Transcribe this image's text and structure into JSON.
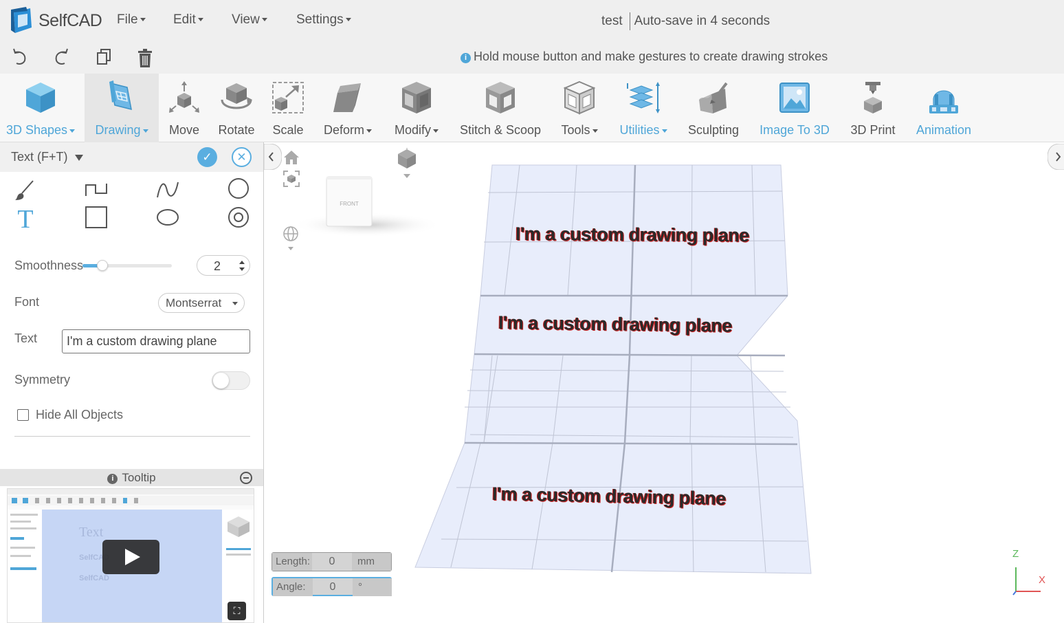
{
  "app": {
    "name": "SelfCAD"
  },
  "menu": [
    {
      "label": "File"
    },
    {
      "label": "Edit"
    },
    {
      "label": "View"
    },
    {
      "label": "Settings"
    }
  ],
  "document": {
    "name": "test",
    "autosave": "Auto-save in 4 seconds"
  },
  "hint": {
    "icon": "i",
    "text": "Hold mouse button and make gestures to create drawing strokes"
  },
  "toolbar": {
    "items": [
      {
        "label": "3D Shapes",
        "icon": "cube-icon",
        "dropdown": true,
        "color": "#4fa6d8"
      },
      {
        "label": "Drawing",
        "icon": "drawing-icon",
        "dropdown": true,
        "color": "#4fa6d8",
        "active": true
      },
      {
        "label": "Move",
        "icon": "move-icon"
      },
      {
        "label": "Rotate",
        "icon": "rotate-icon"
      },
      {
        "label": "Scale",
        "icon": "scale-icon"
      },
      {
        "label": "Deform",
        "icon": "deform-icon",
        "dropdown": true
      },
      {
        "label": "Modify",
        "icon": "modify-icon",
        "dropdown": true
      },
      {
        "label": "Stitch & Scoop",
        "icon": "stitch-icon"
      },
      {
        "label": "Tools",
        "icon": "tools-icon",
        "dropdown": true
      },
      {
        "label": "Utilities",
        "icon": "utilities-icon",
        "dropdown": true,
        "color": "#4fa6d8"
      },
      {
        "label": "Sculpting",
        "icon": "sculpting-icon"
      },
      {
        "label": "Image To 3D",
        "icon": "image-icon",
        "color": "#4fa6d8"
      },
      {
        "label": "3D Print",
        "icon": "printer-icon"
      },
      {
        "label": "Animation",
        "icon": "animation-icon",
        "color": "#4fa6d8"
      }
    ]
  },
  "panel": {
    "title": "Text (F+T)",
    "tools": [
      "brush-icon",
      "step-line-icon",
      "curve-icon",
      "circle-icon",
      "text-icon",
      "square-icon",
      "ellipse-icon",
      "ring-icon"
    ],
    "smoothness": {
      "label": "Smoothness",
      "value": "2",
      "level": 0.22
    },
    "font": {
      "label": "Font",
      "value": "Montserrat"
    },
    "text": {
      "label": "Text",
      "value": "I'm a custom drawing plane"
    },
    "symmetry": {
      "label": "Symmetry",
      "on": false
    },
    "hide_all": {
      "label": "Hide All Objects",
      "checked": false
    }
  },
  "tooltip": {
    "title": "Tooltip",
    "video": {
      "big_text": "Text",
      "line1": "SelfCAD",
      "line2": "SelfCAD"
    }
  },
  "viewport": {
    "cube_face": "FRONT",
    "plane_text": [
      "I'm a custom drawing plane",
      "I'm a custom drawing plane",
      "I'm a custom drawing plane"
    ],
    "length": {
      "label": "Length:",
      "value": "0",
      "unit": "mm"
    },
    "angle": {
      "label": "Angle:",
      "value": "0",
      "unit": "°"
    },
    "axes": {
      "z": "Z",
      "x": "X",
      "z_color": "#5cb85c",
      "x_color": "#e05555"
    }
  },
  "colors": {
    "accent": "#4fa6d8",
    "plane": "#e8edfb"
  }
}
